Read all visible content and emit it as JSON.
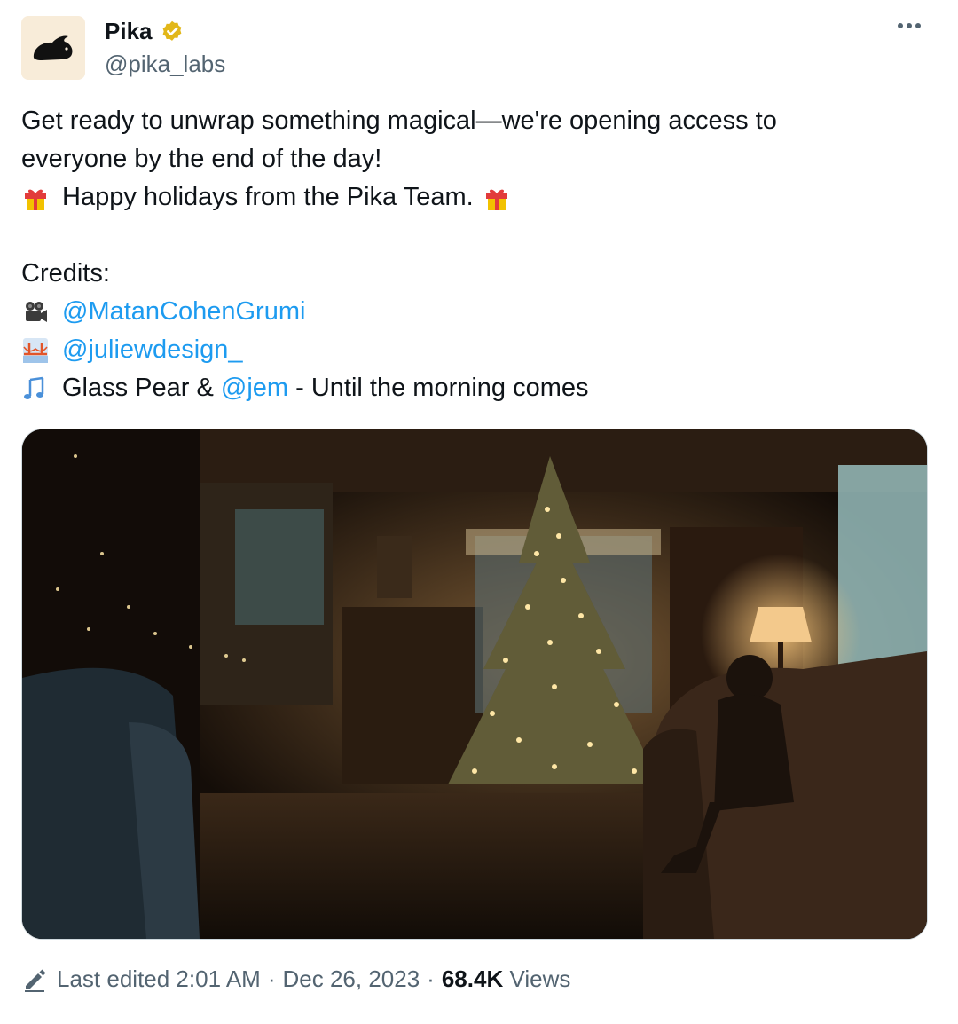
{
  "author": {
    "display_name": "Pika",
    "handle": "@pika_labs",
    "verified_color": "#e2b719",
    "avatar_icon": "pika-rabbit-logo"
  },
  "menu": {
    "icon": "more-dots-icon"
  },
  "tweet": {
    "line1": "Get ready to unwrap something magical—we're opening access to",
    "line2": "everyone by the end of the day!",
    "line3": "Happy holidays from the Pika Team.",
    "credits_label": "Credits:",
    "credit_video": "@MatanCohenGrumi",
    "credit_design": "@juliewdesign_",
    "music_text": "Glass Pear & ",
    "music_mention": "@jem",
    "music_suffix": " - Until the morning comes"
  },
  "meta": {
    "edited_label": "Last edited 2:01 AM",
    "separator": "·",
    "date": "Dec 26, 2023",
    "views_count": "68.4K",
    "views_label": "Views"
  },
  "colors": {
    "link": "#1d9bf0",
    "text": "#0f1419",
    "secondary": "#536471"
  }
}
